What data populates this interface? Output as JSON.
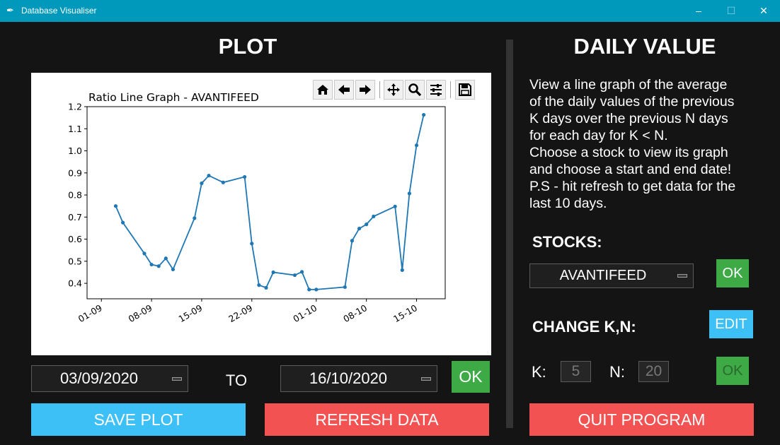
{
  "window": {
    "title": "Database Visualiser",
    "icon": "feather-icon",
    "minimize": "–",
    "maximize": "☐",
    "close": "✕"
  },
  "headings": {
    "plot": "PLOT",
    "daily_value": "DAILY VALUE"
  },
  "toolbar": {
    "icons": [
      "home-icon",
      "back-arrow-icon",
      "forward-arrow-icon",
      "pan-icon",
      "zoom-icon",
      "configure-icon",
      "save-icon"
    ]
  },
  "chart_data": {
    "type": "line",
    "title": "Ratio Line Graph - AVANTIFEED",
    "xlabel": "",
    "ylabel": "",
    "x_ticks": [
      "01-09",
      "08-09",
      "15-09",
      "22-09",
      "01-10",
      "08-10",
      "15-10"
    ],
    "y_ticks": [
      "0.4",
      "0.5",
      "0.6",
      "0.7",
      "0.8",
      "0.9",
      "1.0",
      "1.1",
      "1.2"
    ],
    "ylim": [
      0.33,
      1.2
    ],
    "xlim": [
      "2020-08-30",
      "2020-10-19"
    ],
    "grid": false,
    "color": "#1f77b4",
    "series": [
      {
        "x": [
          "2020-09-03",
          "2020-09-04",
          "2020-09-07",
          "2020-09-08",
          "2020-09-09",
          "2020-09-10",
          "2020-09-11",
          "2020-09-14",
          "2020-09-15",
          "2020-09-16",
          "2020-09-18",
          "2020-09-21",
          "2020-09-22",
          "2020-09-23",
          "2020-09-24",
          "2020-09-25",
          "2020-09-28",
          "2020-09-29",
          "2020-09-30",
          "2020-10-01",
          "2020-10-05",
          "2020-10-06",
          "2020-10-07",
          "2020-10-08",
          "2020-10-09",
          "2020-10-12",
          "2020-10-13",
          "2020-10-14",
          "2020-10-15",
          "2020-10-16"
        ],
        "values": [
          0.75,
          0.675,
          0.535,
          0.485,
          0.478,
          0.513,
          0.463,
          0.695,
          0.853,
          0.888,
          0.857,
          0.882,
          0.58,
          0.392,
          0.38,
          0.45,
          0.437,
          0.452,
          0.372,
          0.372,
          0.383,
          0.593,
          0.648,
          0.667,
          0.703,
          0.748,
          0.46,
          0.807,
          1.025,
          1.163
        ]
      }
    ]
  },
  "date_range": {
    "start": "03/09/2020",
    "to_label": "TO",
    "end": "16/10/2020",
    "ok_label": "OK"
  },
  "buttons": {
    "save_plot": "SAVE PLOT",
    "refresh_data": "REFRESH DATA",
    "quit_program": "QUIT PROGRAM"
  },
  "description": {
    "lines": [
      "View a line graph of the average",
      "of the daily values of the previous",
      "K days over the previous N days",
      "for each day for K < N.",
      "Choose a stock to view its graph",
      "and choose a start and end date!",
      "P.S - hit refresh to get data for the",
      "last 10 days."
    ]
  },
  "stocks": {
    "label": "STOCKS:",
    "selected": "AVANTIFEED",
    "ok_label": "OK"
  },
  "change_kn": {
    "label": "CHANGE K,N:",
    "edit_label": "EDIT",
    "k_label": "K:",
    "k_value": "5",
    "n_label": "N:",
    "n_value": "20",
    "ok_label": "OK"
  },
  "colors": {
    "titlebar": "#0099bb",
    "background": "#141414",
    "green": "#3daa45",
    "blue": "#3cc0f5",
    "red": "#f25252"
  }
}
